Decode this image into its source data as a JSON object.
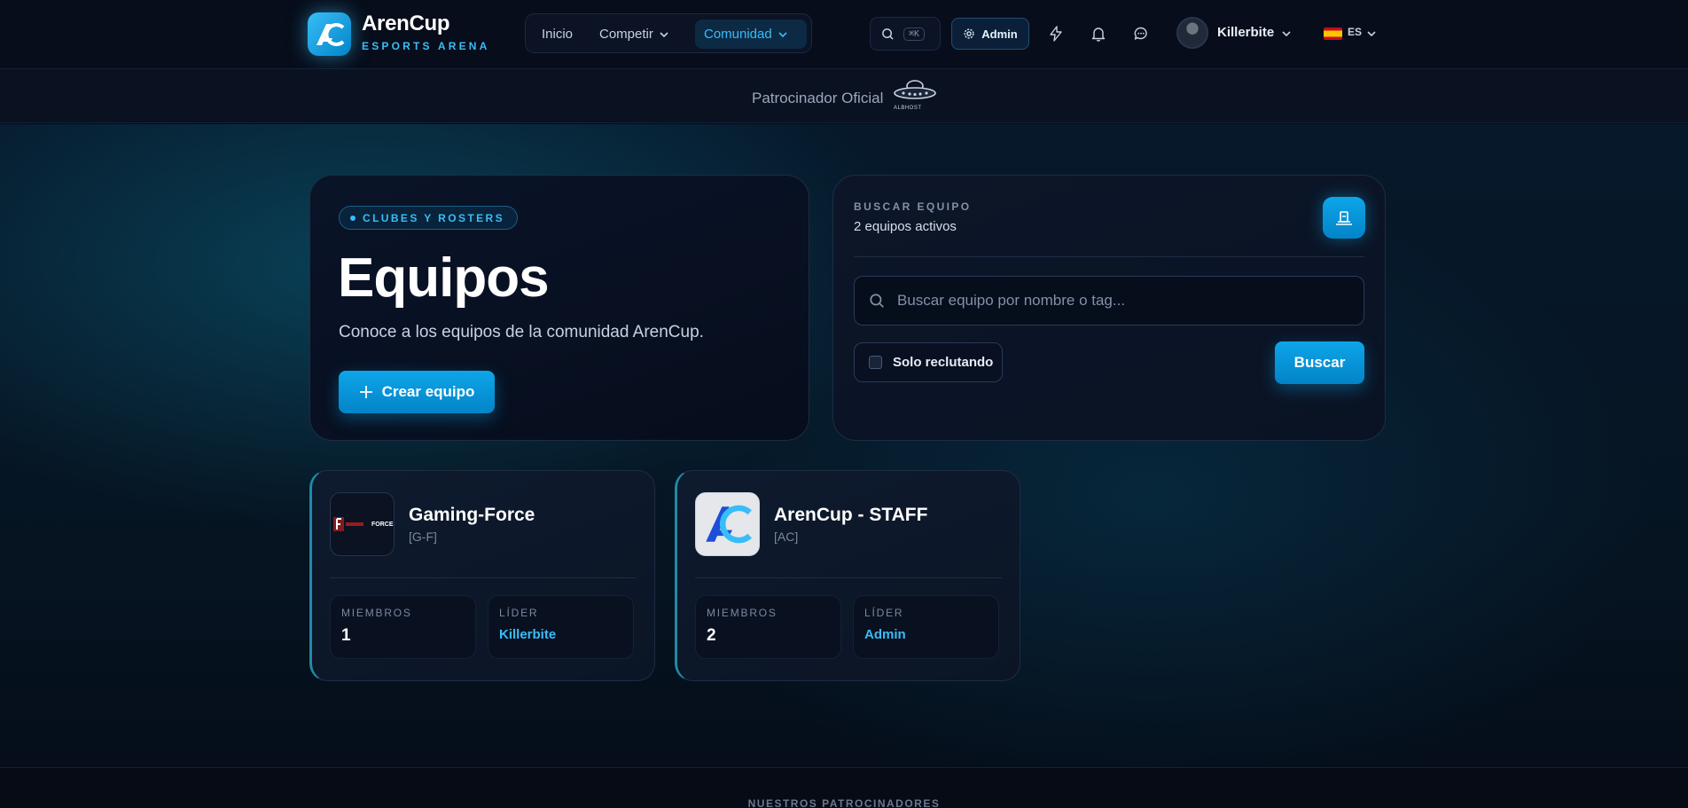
{
  "header": {
    "brand_name": "ArenCup",
    "brand_tagline": "ESPORTS ARENA",
    "nav": [
      {
        "label": "Inicio"
      },
      {
        "label": "Competir"
      },
      {
        "label": "Comunidad"
      }
    ],
    "search_shortcut": "⌘K",
    "admin_label": "Admin",
    "user_name": "Killerbite",
    "language": "ES"
  },
  "sponsor_strip": {
    "label": "Patrocinador Oficial",
    "logo_text": "ALBHOST"
  },
  "hero": {
    "badge": "CLUBES Y ROSTERS",
    "title": "Equipos",
    "subtitle": "Conoce a los equipos de la comunidad ArenCup.",
    "create_button": "Crear equipo"
  },
  "search": {
    "kicker": "BUSCAR EQUIPO",
    "count_text": "2 equipos activos",
    "placeholder": "Buscar equipo por nombre o tag...",
    "checkbox_label": "Solo reclutando",
    "button_label": "Buscar"
  },
  "teams": [
    {
      "name": "Gaming-Force",
      "tag": "[G-F]",
      "members_label": "MIEMBROS",
      "members": "1",
      "leader_label": "LÍDER",
      "leader": "Killerbite",
      "logo_text": "FORCE"
    },
    {
      "name": "ArenCup - STAFF",
      "tag": "[AC]",
      "members_label": "MIEMBROS",
      "members": "2",
      "leader_label": "LÍDER",
      "leader": "Admin"
    }
  ],
  "footer": {
    "label": "NUESTROS PATROCINADORES"
  },
  "colors": {
    "accent": "#38bdf8",
    "button": "#0ea5e9",
    "background": "#050b16",
    "card": "#0e1a2e"
  }
}
